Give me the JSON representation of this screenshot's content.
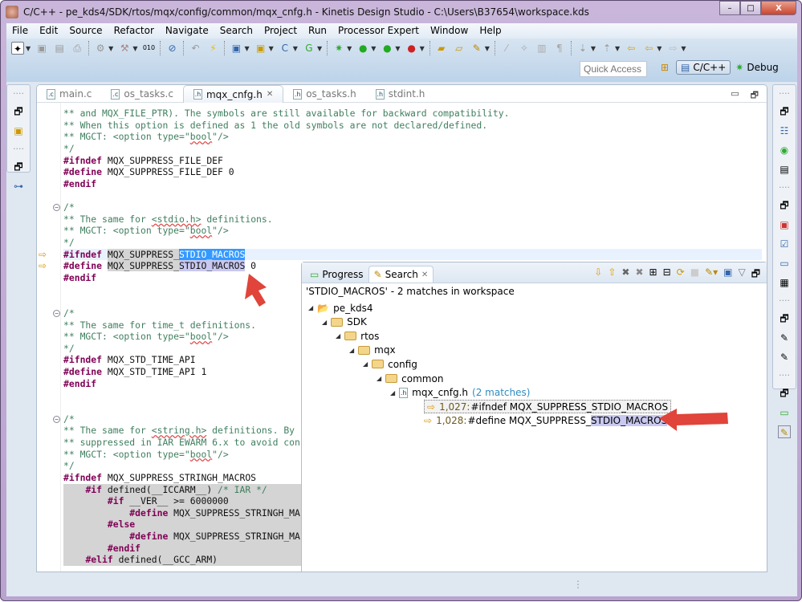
{
  "window": {
    "title": "C/C++ - pe_kds4/SDK/rtos/mqx/config/common/mqx_cnfg.h - Kinetis Design Studio - C:\\Users\\B37654\\workspace.kds",
    "minimize": "–",
    "restore": "□",
    "close": "X"
  },
  "menu": [
    "File",
    "Edit",
    "Source",
    "Refactor",
    "Navigate",
    "Search",
    "Project",
    "Run",
    "Processor Expert",
    "Window",
    "Help"
  ],
  "quick_access": {
    "placeholder": "Quick Access"
  },
  "perspectives": [
    {
      "label": "C/C++",
      "active": true
    },
    {
      "label": "Debug",
      "active": false
    }
  ],
  "editor_tabs": [
    {
      "label": "main.c",
      "icon": "c"
    },
    {
      "label": "os_tasks.c",
      "icon": "c"
    },
    {
      "label": "mqx_cnfg.h",
      "icon": "h",
      "active": true,
      "close": "✕"
    },
    {
      "label": "os_tasks.h",
      "icon": "h"
    },
    {
      "label": "stdint.h",
      "icon": "h"
    }
  ],
  "code": [
    [
      [
        "c",
        "** and MQX_FILE_PTR). The symbols are still available for backward compatibility."
      ]
    ],
    [
      [
        "c",
        "** When this option is defined as 1 the old symbols are not declared/defined."
      ]
    ],
    [
      [
        "c",
        "** MGCT: <option type=\""
      ],
      [
        "c sp",
        "bool"
      ],
      [
        "c",
        "\"/>"
      ]
    ],
    [
      [
        "c",
        "*/"
      ]
    ],
    [
      [
        "d",
        "#ifndef"
      ],
      [
        "n",
        " MQX_SUPPRESS_FILE_DEF"
      ]
    ],
    [
      [
        "d",
        "#define"
      ],
      [
        "n",
        " MQX_SUPPRESS_FILE_DEF 0"
      ]
    ],
    [
      [
        "d",
        "#endif"
      ]
    ],
    [],
    [
      [
        "c",
        "/*"
      ]
    ],
    [
      [
        "c",
        "** The same for "
      ],
      [
        "c sp",
        "<stdio.h>"
      ],
      [
        "c",
        " definitions."
      ]
    ],
    [
      [
        "c",
        "** MGCT: <option type=\""
      ],
      [
        "c sp",
        "bool"
      ],
      [
        "c",
        "\"/>"
      ]
    ],
    [
      [
        "c",
        "*/"
      ]
    ],
    [
      [
        "d",
        "#ifndef"
      ],
      [
        "n",
        " "
      ],
      [
        "n occ",
        "MQX_SUPPRESS_"
      ],
      [
        "sel",
        "STDIO_MACROS"
      ]
    ],
    [
      [
        "d",
        "#define"
      ],
      [
        "n",
        " "
      ],
      [
        "n occ",
        "MQX_SUPPRESS_"
      ],
      [
        "n occ2",
        "STDIO_MACROS"
      ],
      [
        "n",
        " 0"
      ]
    ],
    [
      [
        "d",
        "#endif"
      ]
    ],
    [],
    [],
    [
      [
        "c",
        "/*"
      ]
    ],
    [
      [
        "c",
        "** The same for time_t definitions."
      ]
    ],
    [
      [
        "c",
        "** MGCT: <option type=\""
      ],
      [
        "c sp",
        "bool"
      ],
      [
        "c",
        "\"/>"
      ]
    ],
    [
      [
        "c",
        "*/"
      ]
    ],
    [
      [
        "d",
        "#ifndef"
      ],
      [
        "n",
        " MQX_STD_TIME_API"
      ]
    ],
    [
      [
        "d",
        "#define"
      ],
      [
        "n",
        " MQX_STD_TIME_API 1"
      ]
    ],
    [
      [
        "d",
        "#endif"
      ]
    ],
    [],
    [],
    [
      [
        "c",
        "/*"
      ]
    ],
    [
      [
        "c",
        "** The same for "
      ],
      [
        "c sp",
        "<string.h>"
      ],
      [
        "c",
        " definitions. By"
      ]
    ],
    [
      [
        "c",
        "** suppressed in IAR EWARM 6.x to avoid con"
      ]
    ],
    [
      [
        "c",
        "** MGCT: <option type=\""
      ],
      [
        "c sp",
        "bool"
      ],
      [
        "c",
        "\"/>"
      ]
    ],
    [
      [
        "c",
        "*/"
      ]
    ],
    [
      [
        "d",
        "#ifndef"
      ],
      [
        "n",
        " MQX_SUPPRESS_STRINGH_MACROS"
      ]
    ],
    [
      [
        "n",
        "    "
      ],
      [
        "d",
        "#if"
      ],
      [
        "n",
        " defined(__ICCARM__) "
      ],
      [
        "c",
        "/* IAR */"
      ]
    ],
    [
      [
        "n",
        "        "
      ],
      [
        "d",
        "#if"
      ],
      [
        "n",
        " __VER__ >= 6000000"
      ]
    ],
    [
      [
        "n",
        "            "
      ],
      [
        "d",
        "#define"
      ],
      [
        "n",
        " MQX_SUPPRESS_STRINGH_MA"
      ]
    ],
    [
      [
        "n",
        "        "
      ],
      [
        "d",
        "#else"
      ]
    ],
    [
      [
        "n",
        "            "
      ],
      [
        "d",
        "#define"
      ],
      [
        "n",
        " MQX_SUPPRESS_STRINGH_MA"
      ]
    ],
    [
      [
        "n",
        "        "
      ],
      [
        "d",
        "#endif"
      ]
    ],
    [
      [
        "n",
        "    "
      ],
      [
        "d",
        "#elif"
      ],
      [
        "n",
        " defined(__GCC_ARM)"
      ]
    ]
  ],
  "search_view": {
    "tabs": [
      {
        "label": "Progress"
      },
      {
        "label": "Search",
        "active": true,
        "close": "✕"
      }
    ],
    "summary": "'STDIO_MACROS' - 2 matches in workspace",
    "tree": [
      {
        "level": 0,
        "label": "pe_kds4",
        "icon": "project"
      },
      {
        "level": 1,
        "label": "SDK",
        "icon": "folder"
      },
      {
        "level": 2,
        "label": "rtos",
        "icon": "folder"
      },
      {
        "level": 3,
        "label": "mqx",
        "icon": "folder"
      },
      {
        "level": 4,
        "label": "config",
        "icon": "folder"
      },
      {
        "level": 5,
        "label": "common",
        "icon": "folder"
      },
      {
        "level": 6,
        "label": "mqx_cnfg.h",
        "icon": "file",
        "count": "(2 matches)"
      }
    ],
    "matches": [
      {
        "line": "1,027:",
        "pre": "#ifndef MQX_SUPPRESS_",
        "hit": "STDIO_MACROS",
        "post": "",
        "selected": true
      },
      {
        "line": "1,028:",
        "pre": "#define MQX_SUPPRESS_",
        "hit": "STDIO_MACROS",
        "post": " 0",
        "selected": false
      }
    ]
  },
  "colors": {
    "annotation_arrow": "#e0443a",
    "selection": "#3399ff",
    "comment": "#3f7f5f",
    "keyword": "#7f0055"
  }
}
